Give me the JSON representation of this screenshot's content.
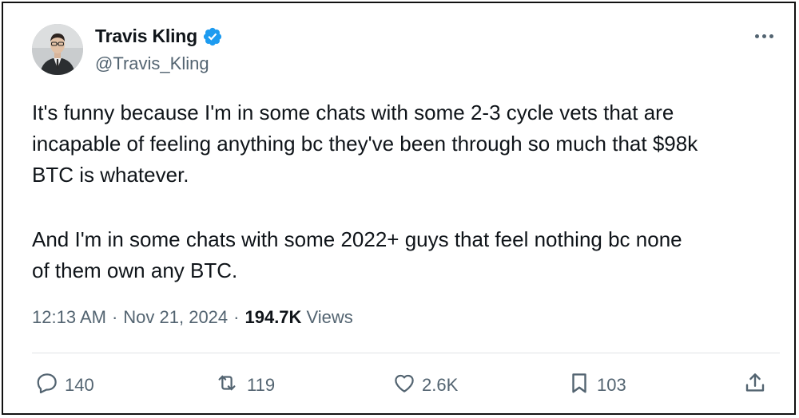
{
  "author": {
    "name": "Travis Kling",
    "handle": "@Travis_Kling",
    "verified": true,
    "badge_color": "#1d9bf0"
  },
  "tweet": {
    "paragraph_1": "It's funny because I'm in some chats with some 2-3 cycle vets that are\nincapable of feeling anything bc they've been through so much that $98k\nBTC is whatever.",
    "paragraph_2": "And I'm in some chats with some 2022+ guys that feel nothing bc none\nof them own any BTC."
  },
  "meta": {
    "time": "12:13 AM",
    "separator": "·",
    "date": "Nov 21, 2024",
    "views_count": "194.7K",
    "views_label": "Views"
  },
  "actions": {
    "replies": "140",
    "reposts": "119",
    "likes": "2.6K",
    "bookmarks": "103"
  },
  "icons": [
    "verified-badge-icon",
    "more-options-icon",
    "reply-icon",
    "repost-icon",
    "like-icon",
    "bookmark-icon",
    "share-icon"
  ],
  "colors": {
    "text": "#0f1419",
    "secondary": "#536471",
    "divider": "#dfe3e6"
  }
}
